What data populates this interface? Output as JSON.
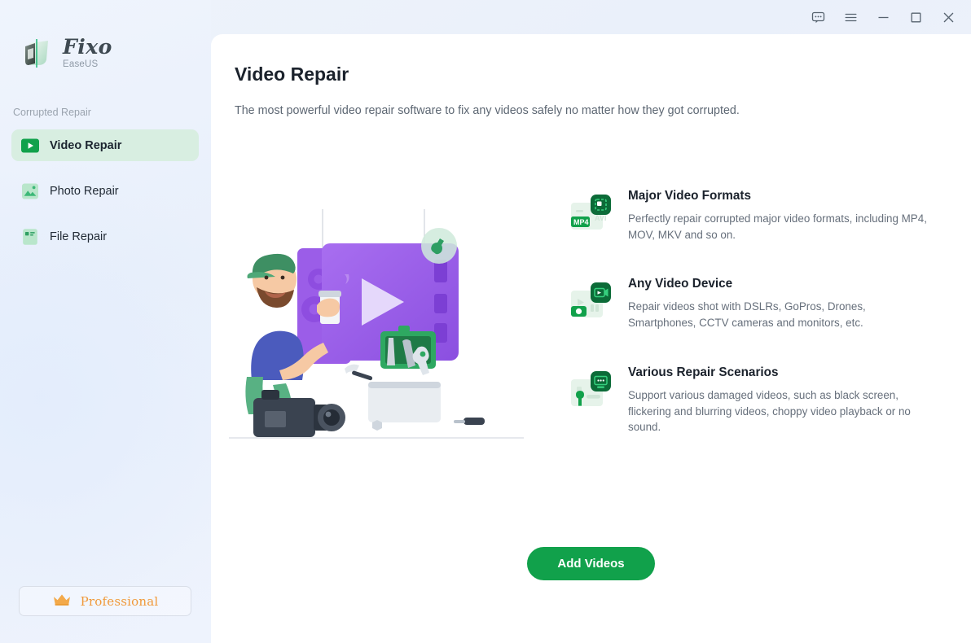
{
  "window": {
    "controls": [
      {
        "name": "feedback-icon",
        "label": "Feedback"
      },
      {
        "name": "menu-icon",
        "label": "Menu"
      },
      {
        "name": "minimize-icon",
        "label": "Minimize"
      },
      {
        "name": "maximize-icon",
        "label": "Maximize"
      },
      {
        "name": "close-icon",
        "label": "Close"
      }
    ]
  },
  "sidebar": {
    "logo": {
      "name": "Fixo",
      "brand": "EaseUS"
    },
    "section_label": "Corrupted Repair",
    "items": [
      {
        "label": "Video Repair",
        "icon": "video-play-icon",
        "active": true
      },
      {
        "label": "Photo Repair",
        "icon": "photo-image-icon",
        "active": false
      },
      {
        "label": "File Repair",
        "icon": "file-document-icon",
        "active": false
      }
    ],
    "pro_button": {
      "label": "Professional",
      "icon": "crown-icon"
    }
  },
  "main": {
    "title": "Video Repair",
    "subtitle": "The most powerful video repair software to fix any videos safely no matter how they got corrupted.",
    "illustration": {
      "name": "video-repair-illustration",
      "labels": [
        "videographer",
        "video-frame",
        "play-button",
        "toolbox",
        "wrench"
      ]
    },
    "features": [
      {
        "icon": "video-format-file-icon",
        "title": "Major Video Formats",
        "desc": "Perfectly repair corrupted major video formats, including MP4, MOV, MKV and so on.",
        "badges": [
          "MP4",
          "AVI"
        ]
      },
      {
        "icon": "video-camera-device-icon",
        "title": "Any Video Device",
        "desc": "Repair videos shot with DSLRs, GoPros, Drones, Smartphones, CCTV cameras and monitors, etc."
      },
      {
        "icon": "repair-scenarios-icon",
        "title": "Various Repair Scenarios",
        "desc": "Support various damaged videos, such as black screen, flickering and blurring videos, choppy video playback or no sound."
      }
    ],
    "cta_button": "Add Videos"
  },
  "colors": {
    "accent_green": "#11a14b",
    "dark_green": "#0c6b38",
    "active_nav_bg": "#d8eee1",
    "pro_orange": "#f0993a",
    "purple": "#9b5de8",
    "window_bg": "#eef3fb"
  }
}
